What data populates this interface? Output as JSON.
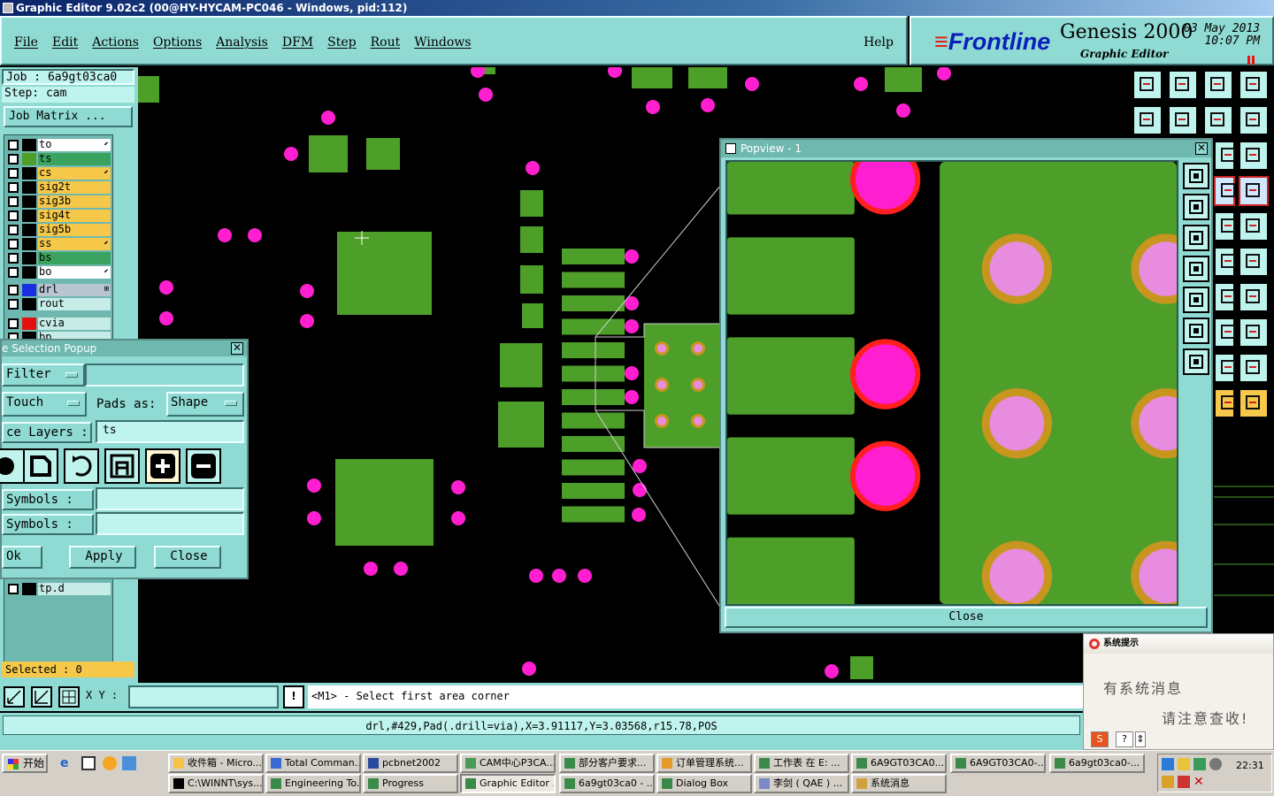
{
  "window": {
    "title": "Graphic Editor 9.02c2 (00@HY-HYCAM-PC046 - Windows, pid:112)"
  },
  "menu": {
    "items": [
      "File",
      "Edit",
      "Actions",
      "Options",
      "Analysis",
      "DFM",
      "Step",
      "Rout",
      "Windows"
    ],
    "help": "Help"
  },
  "brand": {
    "logo_prefix": "≡",
    "logo": "Frontline",
    "product": "Genesis 2000",
    "subtitle": "Graphic Editor",
    "date": "03 May 2013",
    "time": "10:07 PM"
  },
  "job": {
    "job_label": "Job : 6a9gt03ca0",
    "step_label": "Step: cam",
    "matrix_button": "Job Matrix ..."
  },
  "layers": [
    {
      "name": "to",
      "color": "#ffffff",
      "swatch": "#000000",
      "mark": "⬋"
    },
    {
      "name": "ts",
      "color": "#3aa35f",
      "swatch": "#4e9e2a",
      "mark": ""
    },
    {
      "name": "cs",
      "color": "#f5c84a",
      "swatch": "#000000",
      "mark": "⬋"
    },
    {
      "name": "sig2t",
      "color": "#f5c84a",
      "swatch": "#000000",
      "mark": ""
    },
    {
      "name": "sig3b",
      "color": "#f5c84a",
      "swatch": "#000000",
      "mark": ""
    },
    {
      "name": "sig4t",
      "color": "#f5c84a",
      "swatch": "#000000",
      "mark": ""
    },
    {
      "name": "sig5b",
      "color": "#f5c84a",
      "swatch": "#000000",
      "mark": ""
    },
    {
      "name": "ss",
      "color": "#f5c84a",
      "swatch": "#000000",
      "mark": "⬋"
    },
    {
      "name": "bs",
      "color": "#3aa35f",
      "swatch": "#000000",
      "mark": ""
    },
    {
      "name": "bo",
      "color": "#ffffff",
      "swatch": "#000000",
      "mark": "⬋"
    },
    {
      "name": "drl",
      "color": "#b8c4d0",
      "swatch": "#1a2ee0",
      "mark": "⊞"
    },
    {
      "name": "rout",
      "color": "#c7ece8",
      "swatch": "#000000",
      "mark": ""
    },
    {
      "name": "cvia",
      "color": "#c7ece8",
      "swatch": "#e11111",
      "mark": ""
    },
    {
      "name": "bp",
      "color": "#c7ece8",
      "swatch": "#000000",
      "mark": ""
    },
    {
      "name": "tp.d",
      "color": "#c7ece8",
      "swatch": "#000000",
      "mark": ""
    }
  ],
  "selected": "Selected : 0",
  "selection_popup": {
    "title": "e Selection Popup",
    "filter": "Filter",
    "touch": "Touch",
    "pads_as_label": "Pads as:",
    "pads_as_value": "Shape",
    "layers_label": "ce Layers :",
    "layers_value": "ts",
    "symbols1_label": "Symbols :",
    "symbols2_label": "Symbols :",
    "ok": "Ok",
    "apply": "Apply",
    "close": "Close"
  },
  "popview": {
    "title": "Popview - 1",
    "close": "Close"
  },
  "command": {
    "xy_label": "X Y :",
    "xy_value": "",
    "prompt": "<M1> - Select first area corner",
    "status": "drl,#429,Pad(.drill=via),X=3.91117,Y=3.03568,r15.78,POS"
  },
  "notice": {
    "title": "系统提示",
    "line1": "有系统消息",
    "line2": "请注意查收!",
    "btn_help": "?",
    "btn_arrow": "⇕"
  },
  "taskbar": {
    "start": "开始",
    "row1": [
      "收件箱 - Micro...",
      "Total Comman...",
      "pcbnet2002",
      "CAM中心P3CA...",
      "部分客户要求...",
      "订单管理系统...",
      "工作表 在 E: ...",
      "6A9GT03CA0...",
      "6A9GT03CA0-...",
      "6a9gt03ca0-..."
    ],
    "row2": [
      "C:\\WINNT\\sys...",
      "Engineering To...",
      "Progress",
      "Graphic Editor ...",
      "6a9gt03ca0 - ...",
      "Dialog Box",
      "李剑 ( QAE )  ...",
      "系统消息"
    ],
    "clock": "22:31"
  },
  "colors": {
    "ui": "#8fdad2",
    "copper": "#4e9e2a",
    "via": "#ff1fd0",
    "ring": "#c8961e",
    "drill_red": "#ff1f1f"
  }
}
